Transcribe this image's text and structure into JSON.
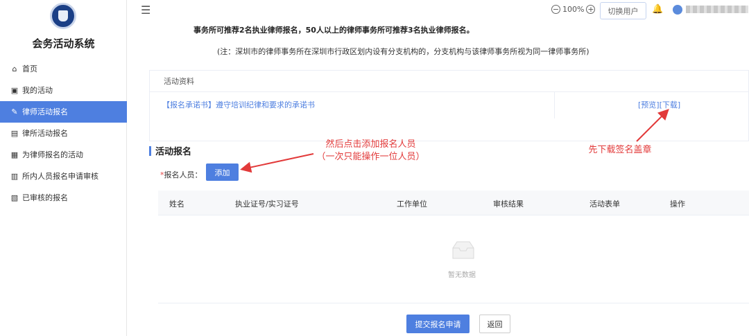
{
  "sidebar": {
    "title": "会务活动系统",
    "items": [
      {
        "label": "首页",
        "icon": "home-icon",
        "active": false
      },
      {
        "label": "我的活动",
        "icon": "calendar-icon",
        "active": false
      },
      {
        "label": "律师活动报名",
        "icon": "edit-icon",
        "active": true
      },
      {
        "label": "律所活动报名",
        "icon": "form-icon",
        "active": false
      },
      {
        "label": "为律师报名的活动",
        "icon": "user-list-icon",
        "active": false
      },
      {
        "label": "所内人员报名申请审核",
        "icon": "audit-icon",
        "active": false
      },
      {
        "label": "已审核的报名",
        "icon": "checked-icon",
        "active": false
      }
    ]
  },
  "header": {
    "zoom": "100%",
    "switch_user": "切换用户"
  },
  "notice": {
    "line2": "事务所可推荐2名执业律师报名，50人以上的律师事务所可推荐3名执业律师报名。",
    "note": "(注：深圳市的律师事务所在深圳市行政区划内设有分支机构的，分支机构与该律师事务所视为同一律师事务所)"
  },
  "materials": {
    "header": "活动资料",
    "link": "【报名承诺书】遵守培训纪律和要求的承诺书",
    "preview": "[预览]",
    "download": "[下载]"
  },
  "registration": {
    "title": "活动报名",
    "label": "报名人员：",
    "add_button": "添加",
    "columns": [
      "姓名",
      "执业证号/实习证号",
      "工作单位",
      "审核结果",
      "活动表单",
      "操作"
    ],
    "empty_text": "暂无数据",
    "submit_button": "提交报名申请",
    "back_button": "返回"
  },
  "annotations": {
    "add_hint_line1": "然后点击添加报名人员",
    "add_hint_line2": "（一次只能操作一位人员）",
    "download_hint": "先下载签名盖章"
  },
  "colors": {
    "accent": "#4e7fe0",
    "annotation": "#e23a3a"
  }
}
